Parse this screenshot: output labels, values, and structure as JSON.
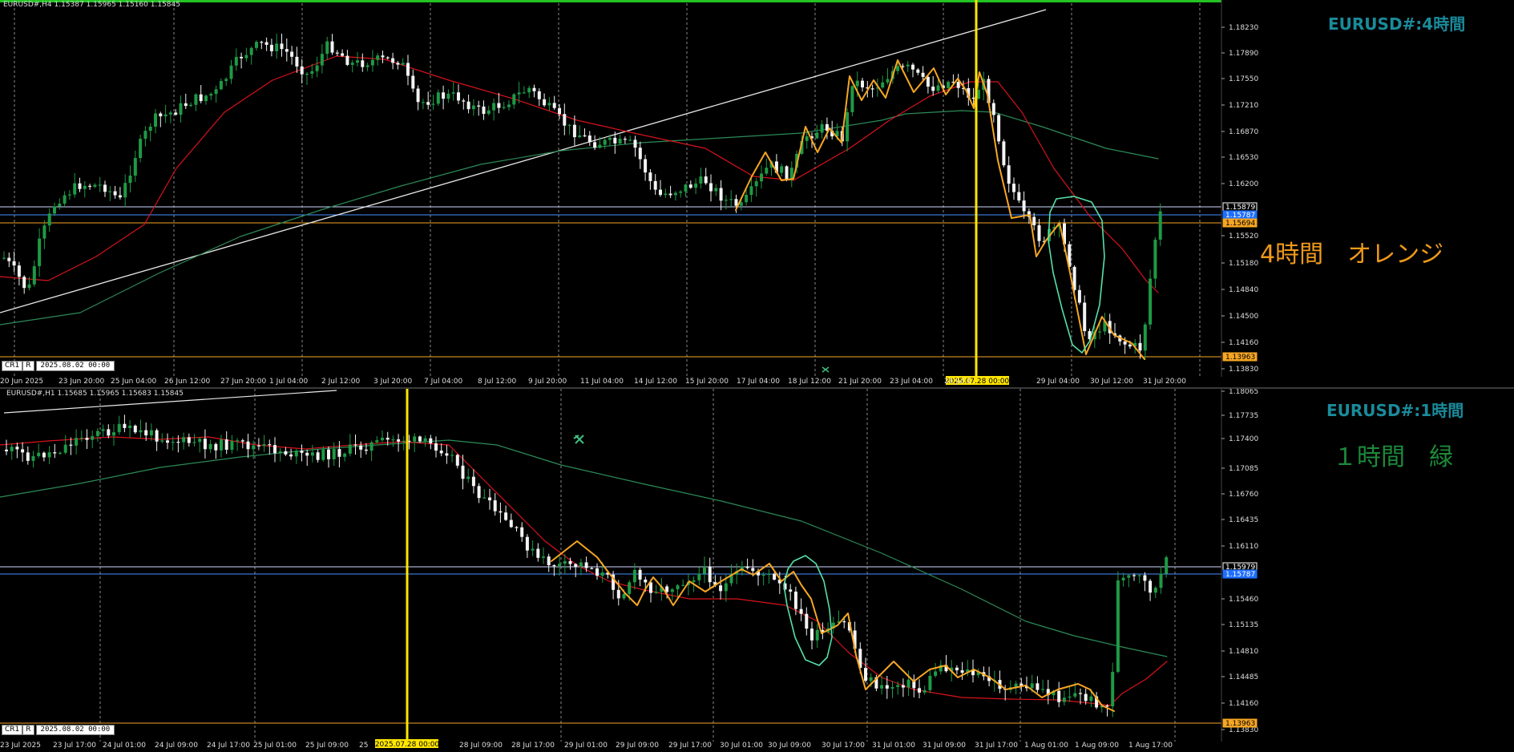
{
  "top": {
    "header": "EURUSD#,H4  1.15387 1.15965 1.15160 1.15845",
    "symbol_label": "EURUSD#:4時間",
    "note": "4時間　オレンジ",
    "cr": "CR1",
    "r": "R",
    "date_box": "2025.08.02 00:00",
    "xticks": [
      "20 Jun 2025",
      "23 Jun 20:00",
      "25 Jun 04:00",
      "26 Jun 12:00",
      "27 Jun 20:00",
      "1 Jul 04:00",
      "2 Jul 12:00",
      "3 Jul 20:00",
      "7 Jul 04:00",
      "8 Jul 12:00",
      "9 Jul 20:00",
      "11 Jul 04:00",
      "14 Jul 12:00",
      "15 Jul 20:00",
      "17 Jul 04:00",
      "18 Jul 12:00",
      "21 Jul 20:00",
      "23 Jul 04:00",
      "24 Jul 1",
      "29 Jul 04:00",
      "30 Jul 12:00",
      "31 Jul 20:00"
    ],
    "cursor_label": "2025.07.28 00:00",
    "price_ticks": [
      "1.18230",
      "1.17890",
      "1.17550",
      "1.17210",
      "1.16870",
      "1.16530",
      "1.16200",
      "1.15520",
      "1.15180",
      "1.14840",
      "1.14500",
      "1.14160",
      "1.13830"
    ],
    "price_tags": {
      "white": "1.15879",
      "blue": "1.15787",
      "orange_a": "1.15694",
      "orange_b": "1.13963"
    },
    "price_min": 1.137,
    "price_max": 1.184
  },
  "bottom": {
    "header": "EURUSD#,H1  1.15685 1.15965 1.15683 1.15845",
    "symbol_label": "EURUSD#:1時間",
    "note": "１時間　緑",
    "cr": "CR1",
    "r": "R",
    "date_box": "2025.08.02 00:00",
    "xticks": [
      "23 Jul 2025",
      "23 Jul 17:00",
      "24 Jul 01:00",
      "24 Jul 09:00",
      "24 Jul 17:00",
      "25 Jul 01:00",
      "25 Jul 09:00",
      "25",
      "28 Jul 09:00",
      "28 Jul 17:00",
      "29 Jul 01:00",
      "29 Jul 09:00",
      "29 Jul 17:00",
      "30 Jul 01:00",
      "30 Jul 09:00",
      "30 Jul 17:00",
      "31 Jul 01:00",
      "31 Jul 09:00",
      "31 Jul 17:00",
      "1 Aug 01:00",
      "1 Aug 09:00",
      "1 Aug 17:00"
    ],
    "cursor_label": "2025.07.28 00:00",
    "price_ticks": [
      "1.18065",
      "1.17735",
      "1.17400",
      "1.17085",
      "1.16760",
      "1.16435",
      "1.16110",
      "1.15460",
      "1.15135",
      "1.14810",
      "1.14485",
      "1.14160",
      "1.13830"
    ],
    "price_tags": {
      "white": "1.15979",
      "blue": "1.15787",
      "orange": "1.13963"
    },
    "price_min": 1.1373,
    "price_max": 1.1815
  },
  "colors": {
    "bull": "#1e9a45",
    "bear": "#f4f4f4",
    "ma_red": "#d8131b",
    "ma_green": "#2c8a58",
    "trend_white": "#e8e8e8",
    "orange": "#f6a623",
    "yellow": "#ffe600",
    "mint": "#55e0a8",
    "grid": "#8a8a8a",
    "label_top": "#1a8b9b",
    "label_note_top": "#f09a1a",
    "label_note_bot": "#1d8a3a"
  },
  "icons": {
    "bottom_marker": "crossed-tools-icon",
    "top_marker": "small-marker-icon"
  }
}
